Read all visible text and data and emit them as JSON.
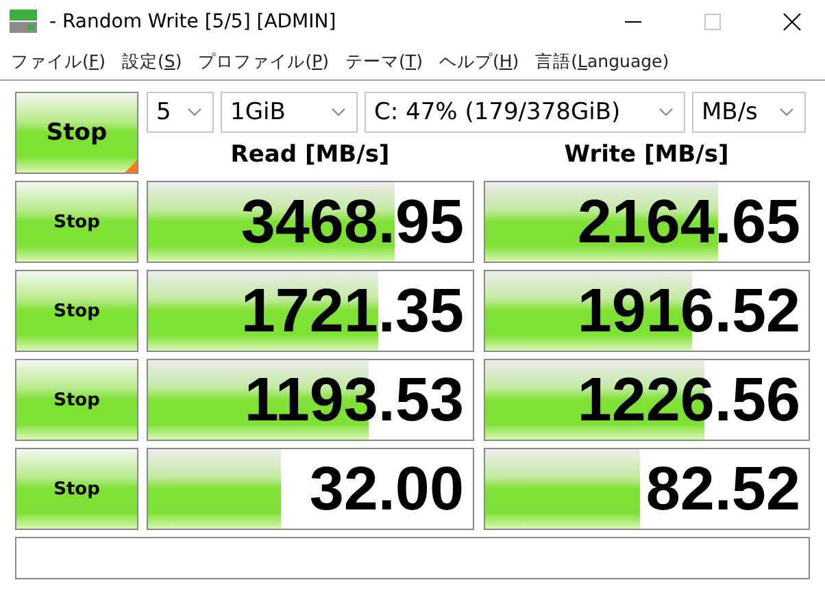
{
  "window": {
    "title": "- Random Write [5/5] [ADMIN]"
  },
  "menu": [
    {
      "before": "ファイル(",
      "key": "F",
      "after": ")"
    },
    {
      "before": "設定(",
      "key": "S",
      "after": ")"
    },
    {
      "before": "プロファイル(",
      "key": "P",
      "after": ")"
    },
    {
      "before": "テーマ(",
      "key": "T",
      "after": ")"
    },
    {
      "before": "ヘルプ(",
      "key": "H",
      "after": ")"
    },
    {
      "before": "言語(",
      "key": "L",
      "after": "anguage)"
    }
  ],
  "main_button": "Stop",
  "selectors": {
    "count": "5",
    "size": "1GiB",
    "drive": "C: 47% (179/378GiB)",
    "unit": "MB/s"
  },
  "headers": {
    "read": "Read [MB/s]",
    "write": "Write [MB/s]"
  },
  "rows": [
    {
      "button": "Stop",
      "read": {
        "value": "3468.95",
        "level": 0.76
      },
      "write": {
        "value": "2164.65",
        "level": 0.72
      }
    },
    {
      "button": "Stop",
      "read": {
        "value": "1721.35",
        "level": 0.71
      },
      "write": {
        "value": "1916.52",
        "level": 0.64
      }
    },
    {
      "button": "Stop",
      "read": {
        "value": "1193.53",
        "level": 0.68
      },
      "write": {
        "value": "1226.56",
        "level": 0.68
      }
    },
    {
      "button": "Stop",
      "read": {
        "value": "32.00",
        "level": 0.41
      },
      "write": {
        "value": "82.52",
        "level": 0.48
      }
    }
  ]
}
